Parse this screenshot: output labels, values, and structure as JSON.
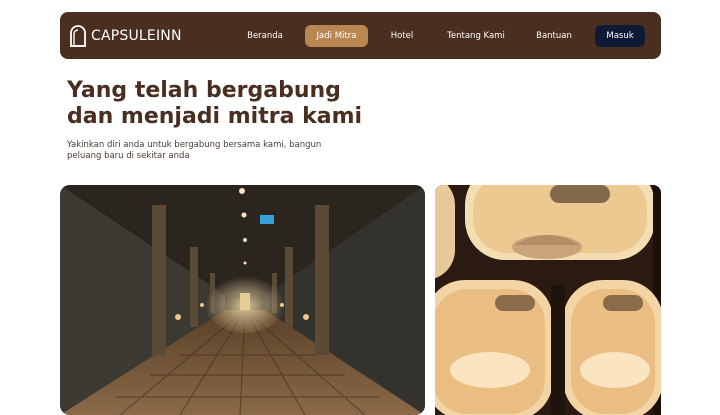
{
  "brand": {
    "name": "CAPSULEINN",
    "icon": "capsule-logo-icon"
  },
  "nav": {
    "items": [
      {
        "label": "Beranda"
      },
      {
        "label": "Jadi Mitra",
        "active": true
      },
      {
        "label": "Hotel"
      },
      {
        "label": "Tentang Kami"
      },
      {
        "label": "Bantuan"
      }
    ],
    "login_label": "Masuk"
  },
  "hero": {
    "title": "Yang telah bergabung dan menjadi mitra kami",
    "subtitle": "Yakinkan diri anda untuk bergabung bersama kami, bangun peluang baru di sekitar anda"
  },
  "colors": {
    "nav_bg": "#4a2e20",
    "active_bg": "#b98751",
    "login_bg": "#0f1a36",
    "title": "#4a2e20"
  },
  "images": [
    {
      "name": "hotel hallway photo"
    },
    {
      "name": "capsule pods photo"
    }
  ]
}
